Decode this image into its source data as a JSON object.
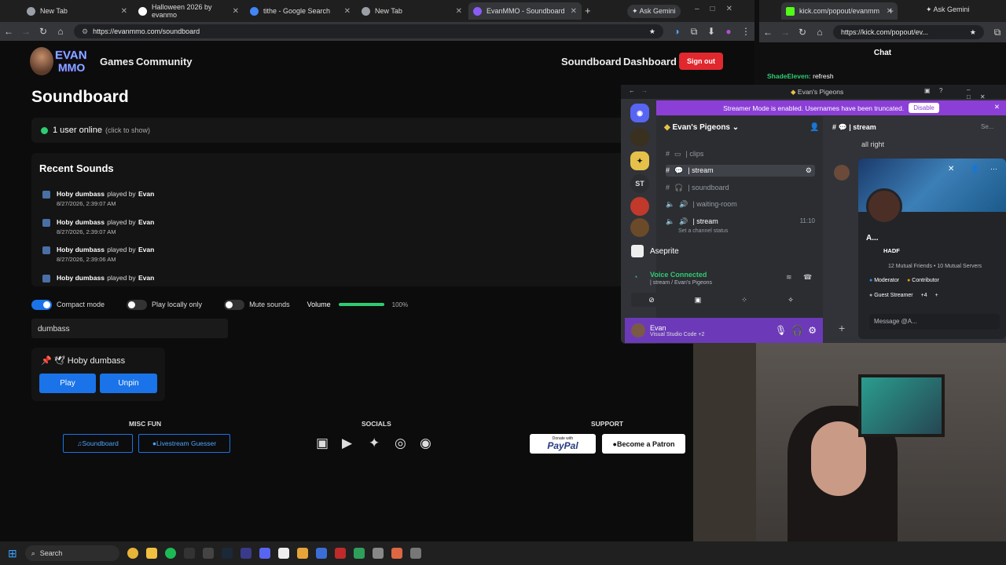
{
  "browser_main": {
    "tabs": [
      {
        "label": "New Tab",
        "color": "#9aa0a6"
      },
      {
        "label": "Halloween 2026 by evanmo",
        "color": "#ffffff"
      },
      {
        "label": "tithe - Google Search",
        "color": "#4285f4"
      },
      {
        "label": "New Tab",
        "color": "#9aa0a6"
      },
      {
        "label": "EvanMMO - Soundboard",
        "color": "#8a5cf6"
      }
    ],
    "new_tab": "+",
    "ask_gemini": "Ask Gemini",
    "url": "https://evanmmo.com/soundboard"
  },
  "site": {
    "logo_top": "EVAN",
    "logo_bottom": "MMO",
    "nav_left": [
      "Games",
      "Community"
    ],
    "nav_right": [
      "Soundboard",
      "Dashboard"
    ],
    "sign_out": "Sign out",
    "title": "Soundboard",
    "online": "1 user online",
    "online_hint": "(click to show)",
    "recent_title": "Recent Sounds",
    "recent": [
      {
        "sound": "Hoby dumbass",
        "by": "played by",
        "user": "Evan",
        "time": "8/27/2026, 2:39:07 AM"
      },
      {
        "sound": "Hoby dumbass",
        "by": "played by",
        "user": "Evan",
        "time": "8/27/2026, 2:39:07 AM"
      },
      {
        "sound": "Hoby dumbass",
        "by": "played by",
        "user": "Evan",
        "time": "8/27/2026, 2:39:06 AM"
      },
      {
        "sound": "Hoby dumbass",
        "by": "played by",
        "user": "Evan",
        "time": ""
      }
    ],
    "toggles": {
      "compact": "Compact mode",
      "local": "Play locally only",
      "mute": "Mute sounds",
      "volume": "Volume",
      "volume_pct": "100%"
    },
    "search_value": "dumbass",
    "card": {
      "name": "Hoby dumbass",
      "play": "Play",
      "unpin": "Unpin"
    },
    "footer": {
      "misc": "MISC FUN",
      "socials": "SOCIALS",
      "support": "SUPPORT",
      "btn_soundboard": "Soundboard",
      "btn_guesser": "Livestream Guesser",
      "paypal_small": "Donate with",
      "paypal": "PayPal",
      "patron": "Become a Patron"
    }
  },
  "browser_chat": {
    "tab": "kick.com/popout/evanmm",
    "ask_gemini": "Ask Gemini",
    "url": "https://kick.com/popout/ev...",
    "chat_title": "Chat",
    "message_user": "ShadeEleven:",
    "message_text": "refresh"
  },
  "discord": {
    "window_title": "Evan's Pigeons",
    "banner": "Streamer Mode is enabled. Usernames have been truncated.",
    "banner_btn": "Disable",
    "server_name": "Evan's Pigeons",
    "server_badge": "ST",
    "channels": [
      {
        "icon": "#",
        "name": "| clips"
      },
      {
        "icon": "#",
        "name": "| stream"
      },
      {
        "icon": "🎧",
        "name": "| soundboard"
      },
      {
        "icon": "🔊",
        "name": "| waiting-room"
      },
      {
        "icon": "🔊",
        "name": "| stream",
        "time": "11:10",
        "status": "Set a channel status"
      }
    ],
    "app_name": "Aseprite",
    "voice_connected": "Voice Connected",
    "voice_sub": "| stream / Evan's Pigeons",
    "user": "Evan",
    "user_status": "Visual Studio Code +2",
    "header_channel": "| stream",
    "header_search": "Se...",
    "msg": "all right",
    "profile": {
      "name": "A...",
      "tag": "HADF",
      "mutual": "12 Mutual Friends • 10 Mutual Servers",
      "roles": [
        "Moderator",
        "Contributor",
        "Guest Streamer"
      ],
      "more": "+4",
      "placeholder": "Message @A..."
    }
  },
  "taskbar": {
    "search": "Search"
  }
}
